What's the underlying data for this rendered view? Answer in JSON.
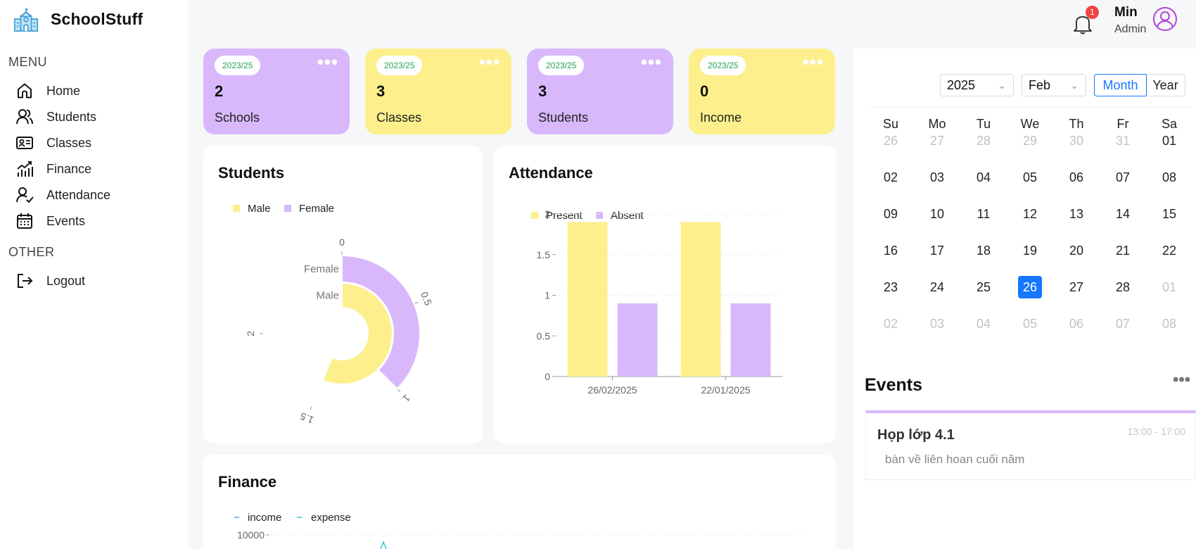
{
  "app": {
    "name": "SchoolStuff"
  },
  "sidebar": {
    "menu_heading": "MENU",
    "other_heading": "OTHER",
    "items": [
      {
        "label": "Home",
        "icon": "home-icon"
      },
      {
        "label": "Students",
        "icon": "students-icon"
      },
      {
        "label": "Classes",
        "icon": "id-card-icon"
      },
      {
        "label": "Finance",
        "icon": "finance-chart-icon"
      },
      {
        "label": "Attendance",
        "icon": "attendance-icon"
      },
      {
        "label": "Events",
        "icon": "calendar-icon"
      }
    ],
    "other_items": [
      {
        "label": "Logout",
        "icon": "logout-icon"
      }
    ]
  },
  "header": {
    "notification_count": "1",
    "user_name": "Min",
    "user_role": "Admin"
  },
  "stats": [
    {
      "badge": "2023/25",
      "value": "2",
      "label": "Schools",
      "color": "#d8b8fb"
    },
    {
      "badge": "2023/25",
      "value": "3",
      "label": "Classes",
      "color": "#fdef8c"
    },
    {
      "badge": "2023/25",
      "value": "3",
      "label": "Students",
      "color": "#d8b8fb"
    },
    {
      "badge": "2023/25",
      "value": "0",
      "label": "Income",
      "color": "#fdef8c"
    }
  ],
  "students_panel": {
    "title": "Students",
    "legend": [
      "Male",
      "Female"
    ],
    "bar_labels": [
      "Female",
      "Male"
    ],
    "ticks": [
      "0",
      "0.5",
      "1",
      "1.5",
      "2"
    ]
  },
  "attendance_panel": {
    "title": "Attendance",
    "legend": [
      "Present",
      "Absent"
    ],
    "ticks": [
      "0",
      "0.5",
      "1",
      "1.5",
      "2"
    ],
    "categories": [
      "26/02/2025",
      "22/01/2025"
    ]
  },
  "finance_panel": {
    "title": "Finance",
    "legend": [
      "income",
      "expense"
    ],
    "first_tick": "10000"
  },
  "calendar": {
    "year": "2025",
    "month": "Feb",
    "mode_month": "Month",
    "mode_year": "Year",
    "weekdays": [
      "Su",
      "Mo",
      "Tu",
      "We",
      "Th",
      "Fr",
      "Sa"
    ],
    "weeks": [
      [
        "26",
        "27",
        "28",
        "29",
        "30",
        "31",
        "01"
      ],
      [
        "02",
        "03",
        "04",
        "05",
        "06",
        "07",
        "08"
      ],
      [
        "09",
        "10",
        "11",
        "12",
        "13",
        "14",
        "15"
      ],
      [
        "16",
        "17",
        "18",
        "19",
        "20",
        "21",
        "22"
      ],
      [
        "23",
        "24",
        "25",
        "26",
        "27",
        "28",
        "01"
      ],
      [
        "02",
        "03",
        "04",
        "05",
        "06",
        "07",
        "08"
      ]
    ],
    "selected": "26"
  },
  "events": {
    "title": "Events",
    "items": [
      {
        "title": "Họp lớp 4.1",
        "time": "13:00 - 17:00",
        "description": "bàn về liên hoan cuối năm"
      }
    ]
  },
  "chart_data": [
    {
      "type": "bar",
      "title": "Students",
      "layout": "radial",
      "categories": [
        "Female",
        "Male"
      ],
      "series": [
        {
          "name": "Male",
          "values": [
            0,
            1.5
          ]
        },
        {
          "name": "Female",
          "values": [
            1,
            0
          ]
        }
      ],
      "ylim": [
        0,
        2
      ],
      "colors": {
        "Male": "#fdef8c",
        "Female": "#d8b8fb"
      },
      "legend": "top-left"
    },
    {
      "type": "bar",
      "title": "Attendance",
      "categories": [
        "26/02/2025",
        "22/01/2025"
      ],
      "series": [
        {
          "name": "Present",
          "values": [
            1.9,
            1.9
          ]
        },
        {
          "name": "Absent",
          "values": [
            0.9,
            0.9
          ]
        }
      ],
      "ylim": [
        0,
        2
      ],
      "yticks": [
        0,
        0.5,
        1,
        1.5,
        2
      ],
      "grid": true,
      "colors": {
        "Present": "#fdef8c",
        "Absent": "#d8b8fb"
      },
      "legend": "top-left"
    },
    {
      "type": "line",
      "title": "Finance",
      "series": [
        {
          "name": "income",
          "values": []
        },
        {
          "name": "expense",
          "values": []
        }
      ],
      "yticks_visible": [
        10000
      ],
      "colors": {
        "income": "#4aa3f0",
        "expense": "#2fc5d6"
      },
      "legend": "top-left"
    }
  ]
}
